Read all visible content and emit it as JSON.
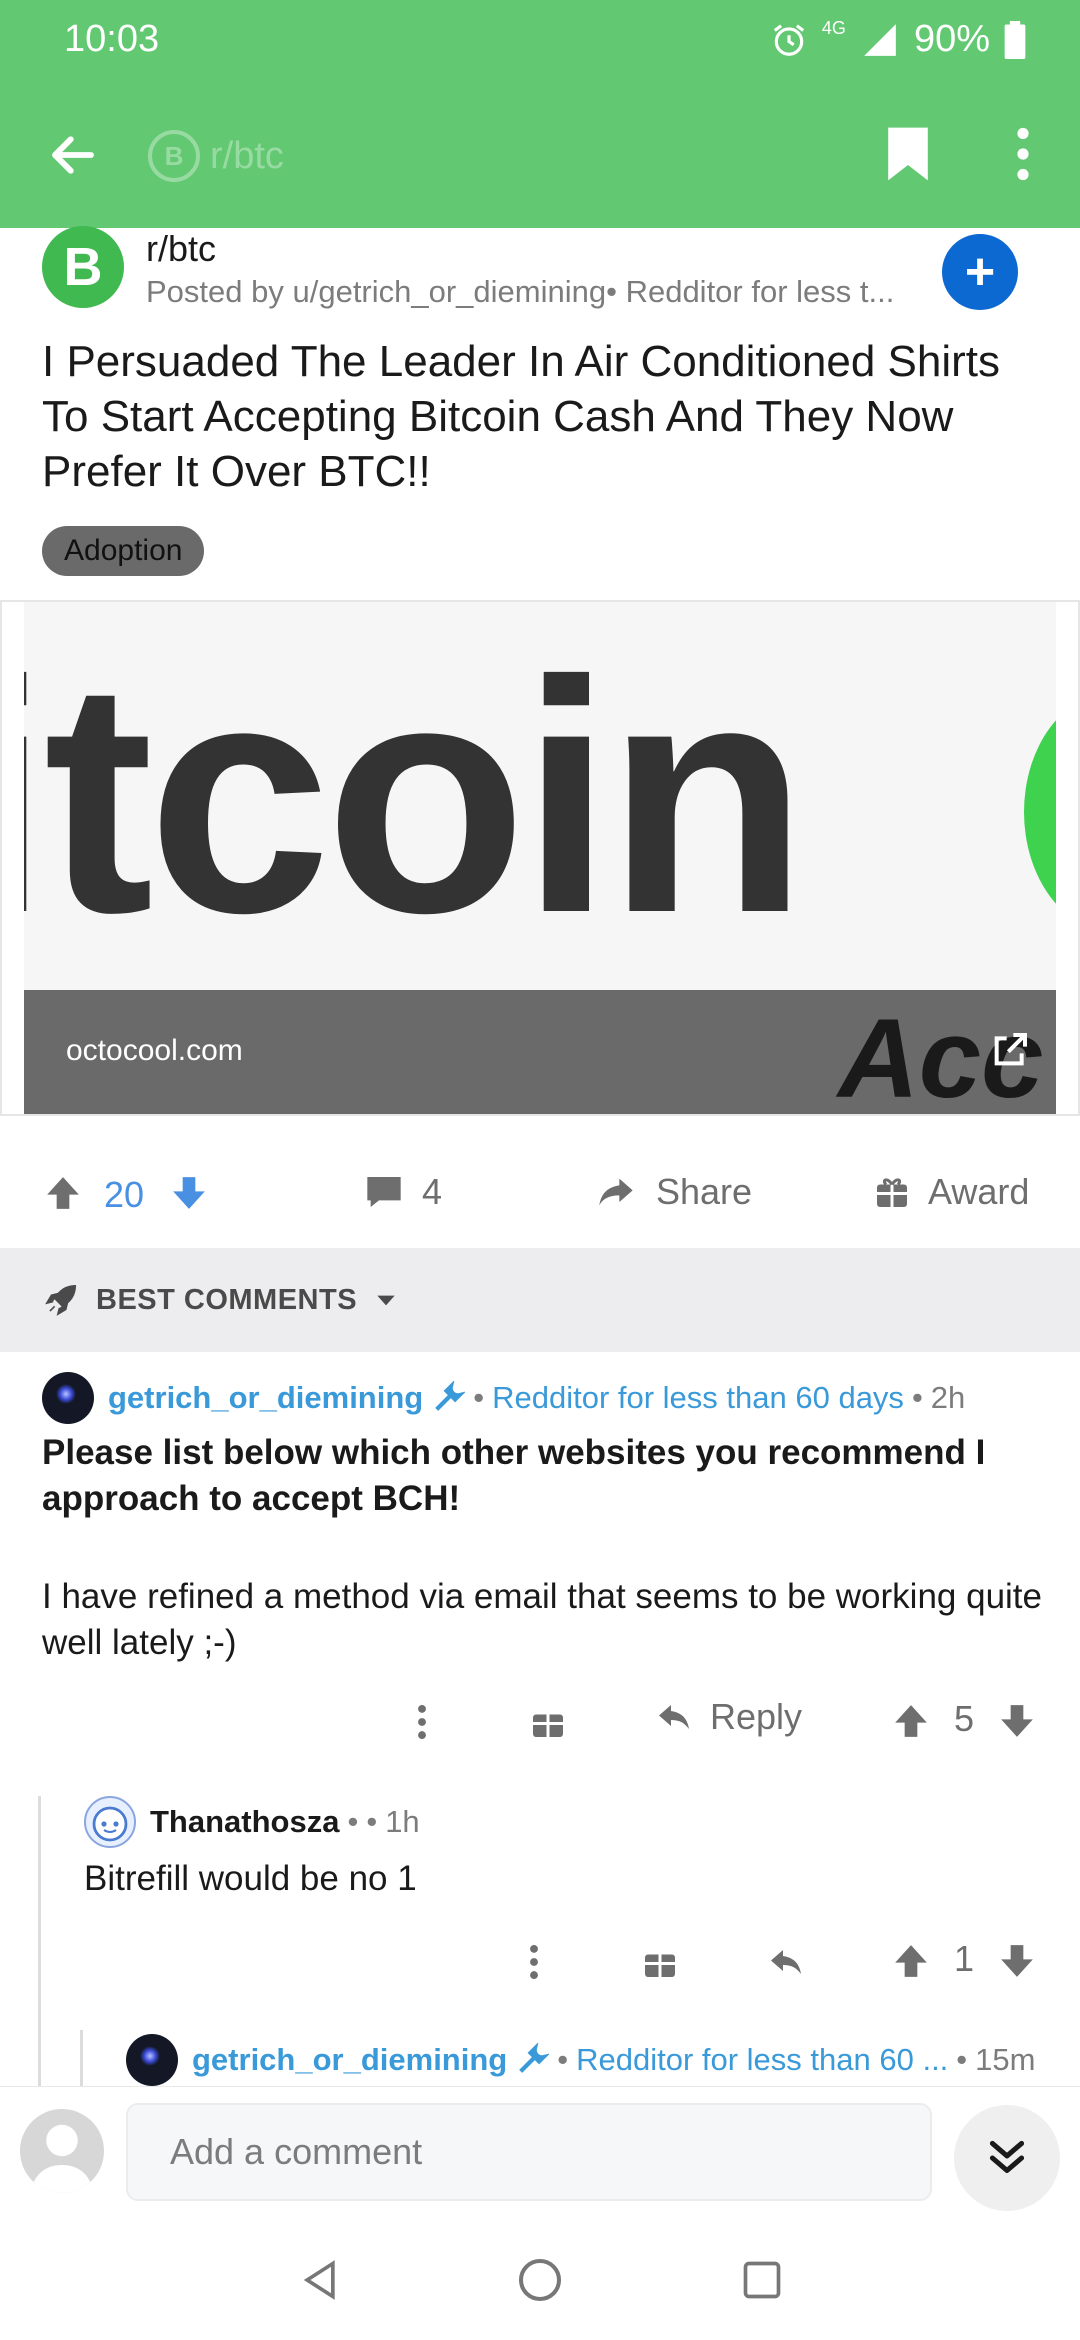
{
  "status_bar": {
    "time": "10:03",
    "network": "4G",
    "battery": "90%"
  },
  "header": {
    "subreddit": "r/btc",
    "coin_symbol": "B"
  },
  "post": {
    "subreddit_name": "r/btc",
    "subreddit_icon_letter": "B",
    "posted_by": "Posted by u/getrich_or_diemining• Redditor for less t...",
    "title": "I Persuaded The Leader In Air Conditioned Shirts To Start Accepting Bitcoin Cash And They Now Prefer It Over BTC!!",
    "flair": "Adoption",
    "link": {
      "image_text": "itcoin",
      "domain": "octocool.com",
      "overlay_text": "Acc"
    }
  },
  "actions": {
    "score": "20",
    "comments": "4",
    "share": "Share",
    "award": "Award"
  },
  "sort": {
    "label": "BEST COMMENTS"
  },
  "comments": [
    {
      "username": "getrich_or_diemining",
      "flair": "Redditor for less than 60 days",
      "age": "2h",
      "bold_text": "Please list below which other websites you recommend I approach to accept BCH!",
      "text": "I have refined a method via email that seems to be working quite well lately ;-)",
      "reply_label": "Reply",
      "score": "5"
    },
    {
      "username": "Thanathosza",
      "age": "1h",
      "text": "Bitrefill would be no 1",
      "score": "1"
    },
    {
      "username": "getrich_or_diemining",
      "flair": "Redditor for less than 60 ...",
      "age": "15m"
    }
  ],
  "composer": {
    "placeholder": "Add a comment"
  },
  "colors": {
    "header_green": "#62c871",
    "accent_blue": "#3a9ad9",
    "join_blue": "#0c69d1",
    "upvote_blue": "#4a90e2"
  }
}
